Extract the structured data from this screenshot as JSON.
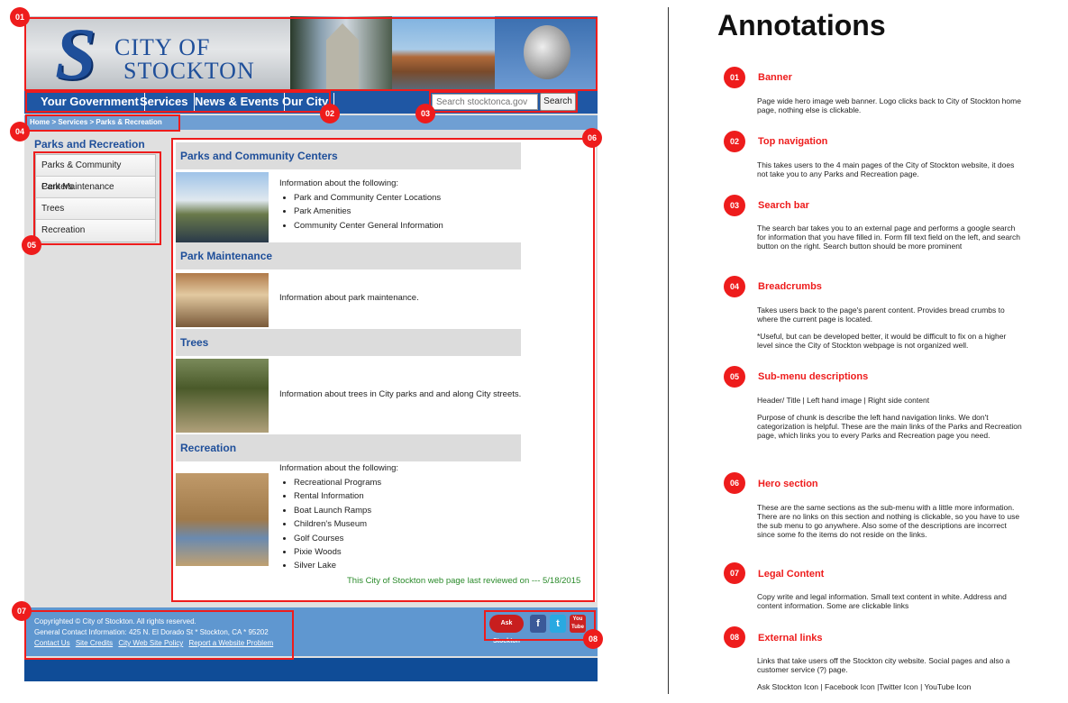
{
  "banner": {
    "logo_letter": "S",
    "logo_city": "CITY OF",
    "logo_stockton": "STOCKTON"
  },
  "topnav": {
    "items": [
      "Your Government",
      "Services",
      "News & Events",
      "Our City"
    ],
    "search_placeholder": "Search stocktonca.gov",
    "search_button": "Search"
  },
  "breadcrumb": "Home > Services > Parks & Recreation",
  "sidebar": {
    "title": "Parks and Recreation",
    "items": [
      "Parks & Community Centers",
      "Park Maintenance",
      "Trees",
      "Recreation"
    ]
  },
  "sections": [
    {
      "title": "Parks and Community Centers",
      "intro": "Information about the following:",
      "bullets": [
        "Park and Community Center Locations",
        "Park Amenities",
        "Community Center General Information"
      ]
    },
    {
      "title": "Park Maintenance",
      "text": "Information about park maintenance."
    },
    {
      "title": "Trees",
      "text": "Information about trees in City parks and and along City streets."
    },
    {
      "title": "Recreation",
      "intro": "Information about the following:",
      "bullets": [
        "Recreational Programs",
        "Rental Information",
        "Boat Launch Ramps",
        "Children's Museum",
        "Golf Courses",
        "Pixie Woods",
        "Silver Lake"
      ]
    }
  ],
  "reviewed": "This City of Stockton web page last reviewed on --- 5/18/2015",
  "footer": {
    "copyright": "Copyrighted © City of Stockton. All rights reserved.",
    "contact": "General Contact Information: 425 N. El Dorado St * Stockton, CA * 95202",
    "links": [
      "Contact Us",
      "Site Credits",
      "City Web Site Policy",
      "Report a Website Problem"
    ],
    "social": {
      "ask": "Ask Stockton",
      "facebook": "f",
      "twitter": "t",
      "youtube": "You Tube"
    }
  },
  "markers": [
    "01",
    "02",
    "03",
    "04",
    "05",
    "06",
    "07",
    "08"
  ],
  "annotations": {
    "title": "Annotations",
    "items": [
      {
        "num": "01",
        "heading": "Banner",
        "paras": [
          "Page wide hero image web banner. Logo clicks back to City of Stockton home page, nothing else is clickable."
        ]
      },
      {
        "num": "02",
        "heading": "Top navigation",
        "paras": [
          "This takes users to the 4 main pages of the City of Stockton website, it does not take you to any Parks and Recreation page."
        ]
      },
      {
        "num": "03",
        "heading": "Search bar",
        "paras": [
          "The search bar takes you to an external page and performs a google search for information that you have filled in. Form fill text field on the left, and search button on the right. Search button should be more prominent"
        ]
      },
      {
        "num": "04",
        "heading": "Breadcrumbs",
        "paras": [
          "Takes users back to the page's parent content. Provides bread crumbs to where the current page is located.",
          "*Useful, but can be developed better, it would be difficult to fix on a higher level since the City of Stockton webpage is not organized well."
        ]
      },
      {
        "num": "05",
        "heading": "Sub-menu descriptions",
        "paras": [
          "Header/ Title | Left hand image | Right side content",
          "Purpose of chunk is describe the left hand navigation links. We don't categorization is helpful. These are the main links of the Parks and Recreation page, which links you to every Parks and Recreation page you need."
        ]
      },
      {
        "num": "06",
        "heading": "Hero section",
        "paras": [
          "These are the same sections as the sub-menu with a little more information. There are no links on this section and nothing is clickable, so you have to use the sub menu to go anywhere. Also some of the descriptions are incorrect since some fo the items do not reside on the links."
        ]
      },
      {
        "num": "07",
        "heading": "Legal Content",
        "paras": [
          "Copy write and legal information. Small text content in white. Address and content information. Some are clickable links"
        ]
      },
      {
        "num": "08",
        "heading": "External links",
        "paras": [
          "Links that take users off the Stockton city website. Social pages and also a customer service (?) page.",
          "Ask Stockton Icon | Facebook Icon |Twitter Icon | YouTube Icon"
        ]
      }
    ]
  }
}
